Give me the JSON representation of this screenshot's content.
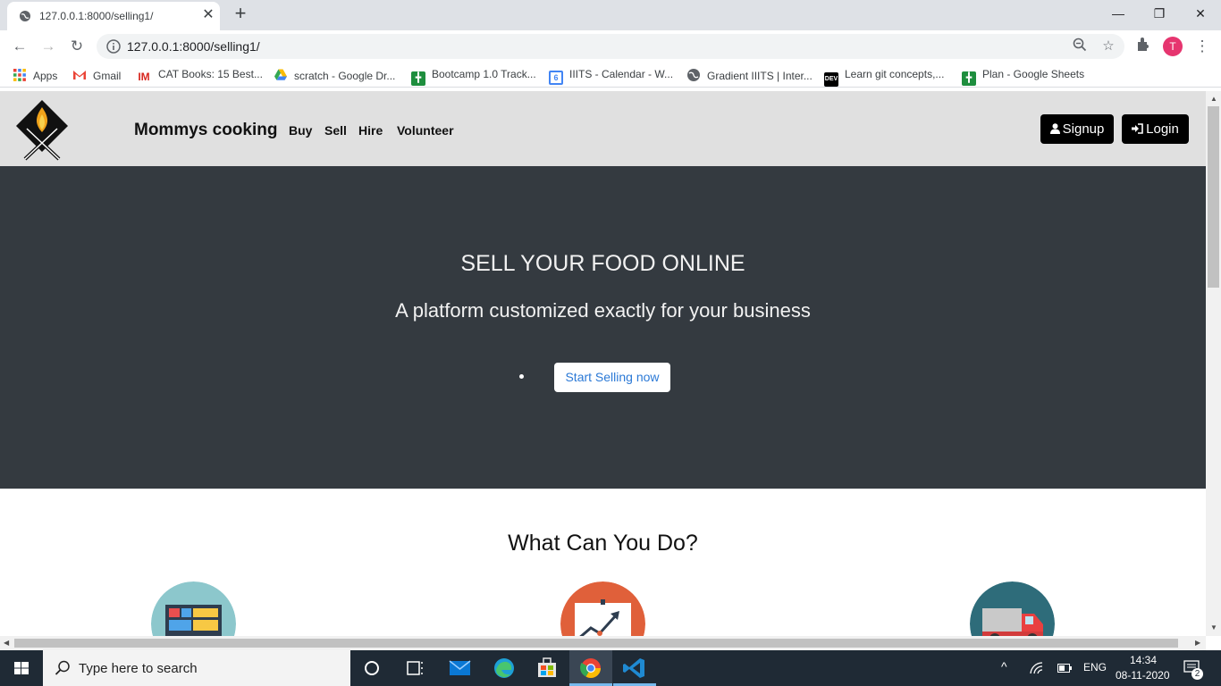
{
  "browser": {
    "tab_title": "127.0.0.1:8000/selling1/",
    "url": "127.0.0.1:8000/selling1/",
    "profile_initial": "T",
    "bookmarks": [
      {
        "label": "Apps",
        "icon": "apps-grid-icon"
      },
      {
        "label": "Gmail",
        "icon": "gmail-icon"
      },
      {
        "label": "CAT Books: 15 Best...",
        "icon": "im-icon"
      },
      {
        "label": "scratch - Google Dr...",
        "icon": "google-drive-icon"
      },
      {
        "label": "Bootcamp 1.0 Track...",
        "icon": "google-sheets-icon"
      },
      {
        "label": "IIITS - Calendar - W...",
        "icon": "google-calendar-icon"
      },
      {
        "label": "Gradient IIITS | Inter...",
        "icon": "globe-icon"
      },
      {
        "label": "Learn git concepts,...",
        "icon": "dev-icon"
      },
      {
        "label": "Plan - Google Sheets",
        "icon": "google-sheets-icon"
      }
    ]
  },
  "site": {
    "brand": "Mommys cooking",
    "nav": [
      "Buy",
      "Sell",
      "Hire",
      "Volunteer"
    ],
    "signup_label": "Signup",
    "login_label": "Login",
    "hero": {
      "title": "SELL YOUR FOOD ONLINE",
      "subtitle": "A platform customized exactly for your business",
      "cta": "Start Selling now"
    },
    "section_title": "What Can You Do?"
  },
  "taskbar": {
    "search_placeholder": "Type here to search",
    "lang": "ENG",
    "time": "14:34",
    "date": "08-11-2020",
    "notifications": "2"
  },
  "colors": {
    "hero_bg": "#343a40",
    "nav_bg": "#e0e0e0",
    "cta_text": "#2b79d6"
  }
}
